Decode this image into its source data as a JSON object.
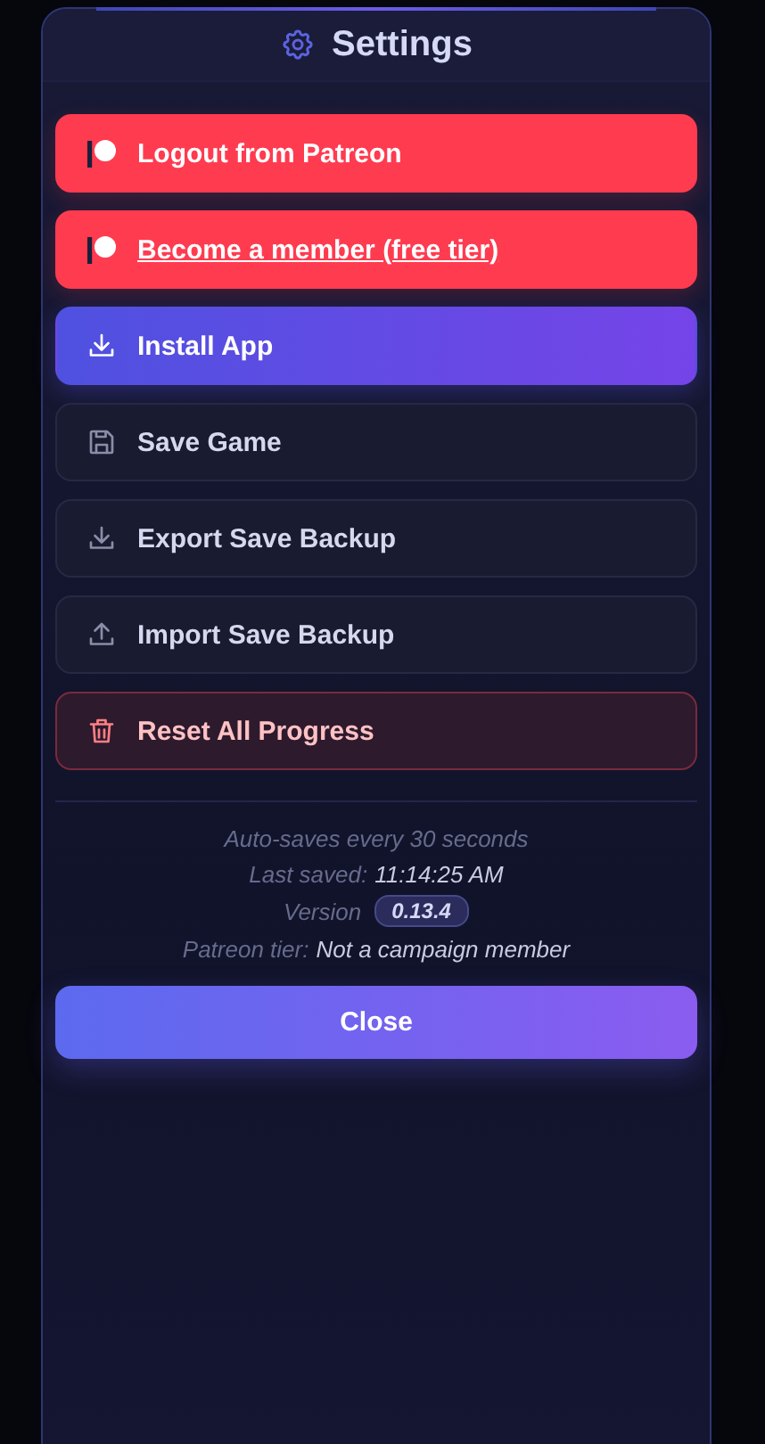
{
  "dialog": {
    "title": "Settings"
  },
  "buttons": [
    {
      "kind": "patreon",
      "label": "Logout from Patreon"
    },
    {
      "kind": "patreon-link",
      "label": "Become a member (free tier)"
    },
    {
      "kind": "install",
      "label": "Install App"
    },
    {
      "kind": "save",
      "label": "Save Game"
    },
    {
      "kind": "export",
      "label": "Export Save Backup"
    },
    {
      "kind": "import",
      "label": "Import Save Backup"
    },
    {
      "kind": "reset",
      "label": "Reset All Progress"
    }
  ],
  "info": [
    {
      "kind": "note",
      "text": "Auto-saves every 30 seconds"
    },
    {
      "kind": "pair",
      "label": "Last saved:",
      "value": "11:14:25 AM"
    },
    {
      "kind": "badge",
      "label": "Version",
      "value": "0.13.4"
    },
    {
      "kind": "pair",
      "label": "Patreon tier:",
      "value": "Not a campaign member"
    }
  ],
  "close_button": "Close"
}
